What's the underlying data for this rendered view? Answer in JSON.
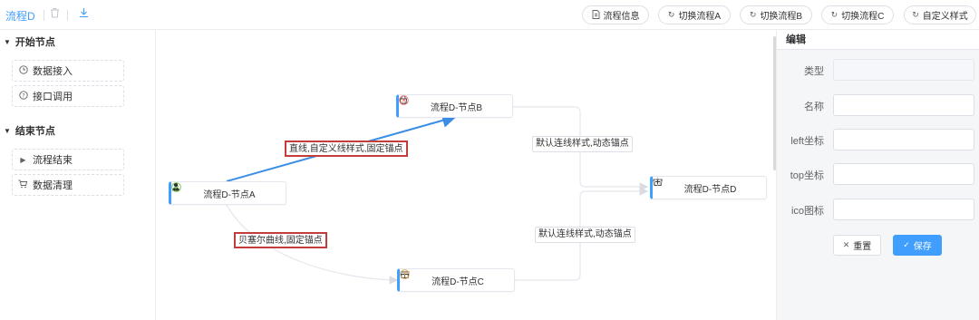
{
  "toolbar": {
    "title": "流程D",
    "delete_icon": "trash-icon",
    "download_icon": "download-icon",
    "buttons": [
      {
        "label": "流程信息",
        "icon": "document-icon"
      },
      {
        "label": "切换流程A",
        "icon": "refresh-icon"
      },
      {
        "label": "切换流程B",
        "icon": "refresh-icon"
      },
      {
        "label": "切换流程C",
        "icon": "refresh-icon"
      },
      {
        "label": "自定义样式",
        "icon": "refresh-icon"
      }
    ]
  },
  "sidebar": {
    "groups": [
      {
        "title": "开始节点",
        "items": [
          {
            "label": "数据接入",
            "icon": "clock-icon"
          },
          {
            "label": "接口调用",
            "icon": "question-icon"
          }
        ]
      },
      {
        "title": "结束节点",
        "items": [
          {
            "label": "流程结束",
            "icon": "caret-right-icon"
          },
          {
            "label": "数据清理",
            "icon": "cart-icon"
          }
        ]
      }
    ]
  },
  "canvas": {
    "nodes": {
      "a": {
        "label": "流程D-节点A",
        "icon": "user-icon",
        "state": "success-icon"
      },
      "b": {
        "label": "流程D-节点B",
        "icon": "bag-icon",
        "state": "error-icon"
      },
      "c": {
        "label": "流程D-节点C",
        "icon": "gift-icon",
        "state": "warning-icon"
      },
      "d": {
        "label": "流程D-节点D",
        "icon": "gift-icon",
        "state": "loading-icon"
      }
    },
    "edges": {
      "ab": "直线,自定义线样式,固定锚点",
      "ac": "贝塞尔曲线,固定锚点",
      "bd": "默认连线样式,动态锚点",
      "cd": "默认连线样式,动态锚点"
    }
  },
  "editor": {
    "title": "编辑",
    "fields": [
      {
        "label": "类型",
        "value": "",
        "disabled": true
      },
      {
        "label": "名称",
        "value": ""
      },
      {
        "label": "left坐标",
        "value": ""
      },
      {
        "label": "top坐标",
        "value": ""
      },
      {
        "label": "ico图标",
        "value": ""
      }
    ],
    "reset_label": "重置",
    "save_label": "保存"
  }
}
